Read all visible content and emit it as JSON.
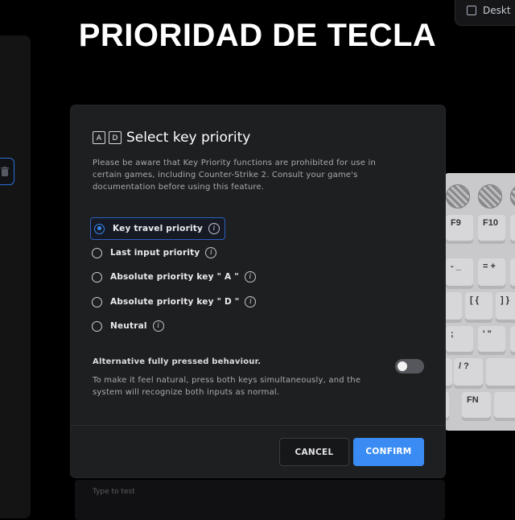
{
  "page": {
    "title": "PRIORIDAD DE TECLA",
    "top_right_label": "Deskt"
  },
  "dialog": {
    "keycap_a": "A",
    "keycap_d": "D",
    "title": "Select key priority",
    "warning": "Please be aware that Key Priority functions are prohibited for use in certain games, including Counter-Strike 2. Consult your game's documentation before using this feature.",
    "options": [
      {
        "label": "Key travel priority",
        "selected": true
      },
      {
        "label": "Last input priority",
        "selected": false
      },
      {
        "label": "Absolute priority key \" A \"",
        "selected": false
      },
      {
        "label": "Absolute priority key \" D \"",
        "selected": false
      },
      {
        "label": "Neutral",
        "selected": false
      }
    ],
    "info_glyph": "i",
    "alternative": {
      "title": "Alternative fully pressed behaviour.",
      "description": "To make it feel natural, press both keys simultaneously, and the system will recognize both inputs as normal.",
      "enabled": false
    },
    "cancel_label": "CANCEL",
    "confirm_label": "CONFIRM"
  },
  "keyboard": {
    "keys": [
      "F9",
      "F10",
      "- _",
      "= +",
      "[ {",
      "] }",
      ";",
      "' \"",
      "/ ?",
      "FN"
    ]
  },
  "bottom": {
    "placeholder": "Type to test"
  },
  "colors": {
    "accent": "#3a8cf4",
    "dialog_bg": "#1e1f21",
    "page_bg": "#000000"
  }
}
